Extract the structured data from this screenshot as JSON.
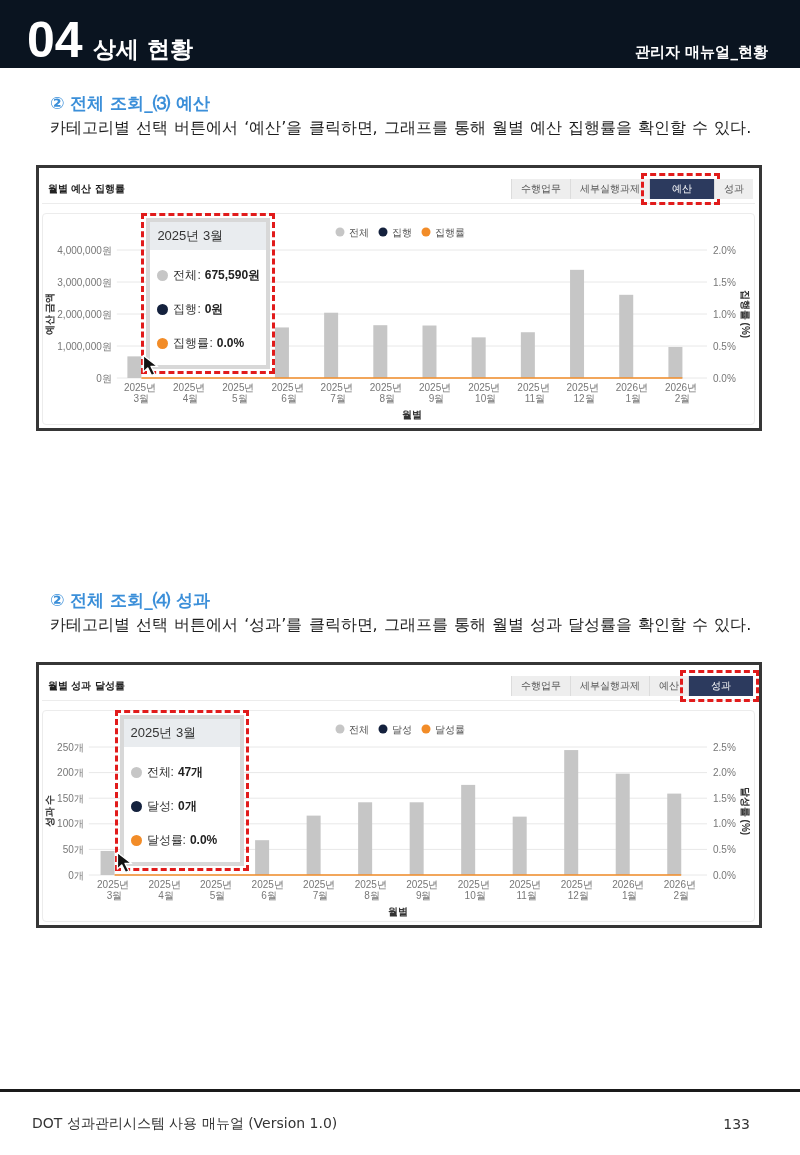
{
  "header": {
    "chapter_number": "04",
    "chapter_title": "상세 현황",
    "manual_section": "관리자 매뉴얼_현황"
  },
  "sections": [
    {
      "heading": "② 전체 조회_⑶ 예산",
      "description": "카테고리별 선택 버튼에서 ‘예산’을 클릭하면, 그래프를 통해 월별 예산 집행률을 확인할 수 있다.",
      "screenshot": {
        "title": "월별 예산 집행률",
        "tabs": [
          {
            "label": "수행업무",
            "selected": false,
            "highlighted": false
          },
          {
            "label": "세부실행과제",
            "selected": false,
            "highlighted": false
          },
          {
            "label": "예산",
            "selected": true,
            "highlighted": true
          },
          {
            "label": "성과",
            "selected": false,
            "highlighted": false
          }
        ],
        "chart_data": {
          "type": "bar",
          "grid": true,
          "legend": "top",
          "xlabel": "월별",
          "ylabel": "예산 금액",
          "y2label": "집행률 (%)",
          "categories": [
            "2025년 3월",
            "2025년 4월",
            "2025년 5월",
            "2025년 6월",
            "2025년 7월",
            "2025년 8월",
            "2025년 9월",
            "2025년 10월",
            "2025년 11월",
            "2025년 12월",
            "2026년 1월",
            "2026년 2월"
          ],
          "series": [
            {
              "name": "전체",
              "type": "bar",
              "color": "#c6c6c6",
              "values": [
                675590,
                null,
                null,
                1580000,
                2040000,
                1650000,
                1640000,
                1270000,
                1430000,
                3380000,
                2600000,
                970000
              ]
            },
            {
              "name": "집행",
              "type": "bar",
              "color": "#14213d",
              "values": [
                0,
                0,
                0,
                0,
                0,
                0,
                0,
                0,
                0,
                0,
                0,
                0
              ]
            },
            {
              "name": "집행률",
              "type": "line",
              "color": "#f28c28",
              "values": [
                0,
                0,
                0,
                0,
                0,
                0,
                0,
                0,
                0,
                0,
                0,
                0
              ]
            }
          ],
          "ylim": [
            0,
            4000000
          ],
          "yticks": [
            {
              "value": 0,
              "label": "0원"
            },
            {
              "value": 1000000,
              "label": "1,000,000원"
            },
            {
              "value": 2000000,
              "label": "2,000,000원"
            },
            {
              "value": 3000000,
              "label": "3,000,000원"
            },
            {
              "value": 4000000,
              "label": "4,000,000원"
            }
          ],
          "y2lim": [
            0,
            2
          ],
          "y2ticks": [
            {
              "value": 0,
              "label": "0.0%"
            },
            {
              "value": 0.5,
              "label": "0.5%"
            },
            {
              "value": 1,
              "label": "1.0%"
            },
            {
              "value": 1.5,
              "label": "1.5%"
            },
            {
              "value": 2,
              "label": "2.0%"
            }
          ]
        },
        "tooltip": {
          "title": "2025년 3월",
          "highlighted": true,
          "items": [
            {
              "label": "전체:",
              "value": "675,590원",
              "color": "#c6c6c6"
            },
            {
              "label": "집행:",
              "value": "0원",
              "color": "#14213d"
            },
            {
              "label": "집행률:",
              "value": "0.0%",
              "color": "#f28c28"
            }
          ]
        }
      }
    },
    {
      "heading": "② 전체 조회_⑷ 성과",
      "description": "카테고리별 선택 버튼에서 ‘성과’를 클릭하면, 그래프를 통해 월별 성과 달성률을 확인할 수 있다.",
      "screenshot": {
        "title": "월별 성과 달성률",
        "tabs": [
          {
            "label": "수행업무",
            "selected": false,
            "highlighted": false
          },
          {
            "label": "세부실행과제",
            "selected": false,
            "highlighted": false
          },
          {
            "label": "예산",
            "selected": false,
            "highlighted": false
          },
          {
            "label": "성과",
            "selected": true,
            "highlighted": true
          }
        ],
        "chart_data": {
          "type": "bar",
          "grid": true,
          "legend": "top",
          "xlabel": "월별",
          "ylabel": "성과 수",
          "y2label": "달성률 (%)",
          "categories": [
            "2025년 3월",
            "2025년 4월",
            "2025년 5월",
            "2025년 6월",
            "2025년 7월",
            "2025년 8월",
            "2025년 9월",
            "2025년 10월",
            "2025년 11월",
            "2025년 12월",
            "2026년 1월",
            "2026년 2월"
          ],
          "series": [
            {
              "name": "전체",
              "type": "bar",
              "color": "#c6c6c6",
              "values": [
                47,
                null,
                null,
                68,
                116,
                142,
                142,
                176,
                114,
                244,
                198,
                159
              ]
            },
            {
              "name": "달성",
              "type": "bar",
              "color": "#14213d",
              "values": [
                0,
                0,
                0,
                0,
                0,
                0,
                0,
                0,
                0,
                0,
                0,
                0
              ]
            },
            {
              "name": "달성률",
              "type": "line",
              "color": "#f28c28",
              "values": [
                0,
                0,
                0,
                0,
                0,
                0,
                0,
                0,
                0,
                0,
                0,
                0
              ]
            }
          ],
          "ylim": [
            0,
            250
          ],
          "yticks": [
            {
              "value": 0,
              "label": "0개"
            },
            {
              "value": 50,
              "label": "50개"
            },
            {
              "value": 100,
              "label": "100개"
            },
            {
              "value": 150,
              "label": "150개"
            },
            {
              "value": 200,
              "label": "200개"
            },
            {
              "value": 250,
              "label": "250개"
            }
          ],
          "y2lim": [
            0,
            2.5
          ],
          "y2ticks": [
            {
              "value": 0,
              "label": "0.0%"
            },
            {
              "value": 0.5,
              "label": "0.5%"
            },
            {
              "value": 1,
              "label": "1.0%"
            },
            {
              "value": 1.5,
              "label": "1.5%"
            },
            {
              "value": 2,
              "label": "2.0%"
            },
            {
              "value": 2.5,
              "label": "2.5%"
            }
          ]
        },
        "tooltip": {
          "title": "2025년 3월",
          "highlighted": true,
          "items": [
            {
              "label": "전체:",
              "value": "47개",
              "color": "#c6c6c6"
            },
            {
              "label": "달성:",
              "value": "0개",
              "color": "#14213d"
            },
            {
              "label": "달성률:",
              "value": "0.0%",
              "color": "#f28c28"
            }
          ]
        }
      }
    }
  ],
  "footer": {
    "text": "DOT 성과관리시스템 사용 매뉴얼 (Version 1.0)",
    "page": "133"
  }
}
